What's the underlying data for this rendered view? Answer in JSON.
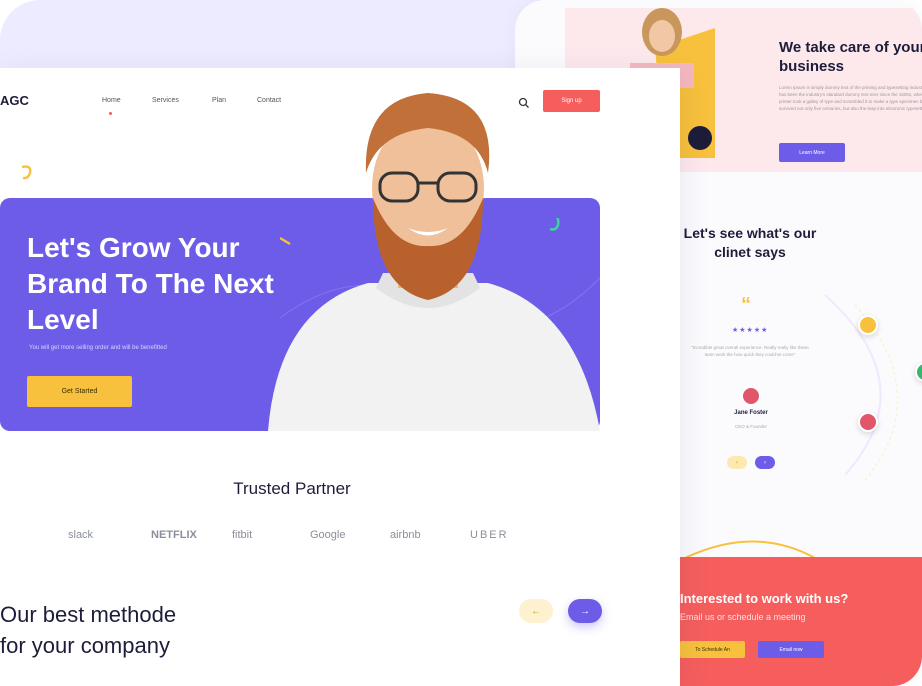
{
  "brand": {
    "logo": "AGC"
  },
  "nav": {
    "items": [
      "Home",
      "Services",
      "Plan",
      "Contact"
    ],
    "signup_label": "Sign up"
  },
  "hero": {
    "title": "Let's Grow Your Brand To The Next Level",
    "subtitle": "You will get more selling order and will be benefitted",
    "cta_label": "Get Started"
  },
  "partners": {
    "title": "Trusted Partner",
    "logos": [
      "slack",
      "NETFLIX",
      "fitbit",
      "Google",
      "airbnb",
      "UBER"
    ]
  },
  "methode": {
    "line1": "Our best methode",
    "line2": "for your company",
    "prev_icon": "arrow-left-icon",
    "next_icon": "arrow-right-icon"
  },
  "about": {
    "title": "We take care of your business",
    "body": "Lorem Ipsum is simply dummy text of the printing and typesetting industry. Lorem Ipsum has been the industry's standard dummy text ever since the 1500s, when an unknown printer took a galley of type and scrambled it to make a type specimen book. It has survived not only five centuries, but also the leap into electronic typesetting.",
    "cta_label": "Learn More"
  },
  "testimonial": {
    "title": "Let's see what's our clinet says",
    "quote_mark": "“",
    "stars": "★★★★★",
    "quote": "\"Incredible great overall experience. Really really like these team work the how quick they could've come\"",
    "name": "Jane Foster",
    "role": "CEO & Founder"
  },
  "cta": {
    "title": "Interested to work with us?",
    "subtitle": "Email us or schedule a meeting",
    "schedule_label": "To Schedule An",
    "email_label": "Email now"
  },
  "colors": {
    "primary": "#6c5ce7",
    "accent_red": "#f65e5e",
    "accent_yellow": "#f7c13d",
    "lilac_bg": "#ecebff",
    "pink_bg": "#fde9ec"
  }
}
